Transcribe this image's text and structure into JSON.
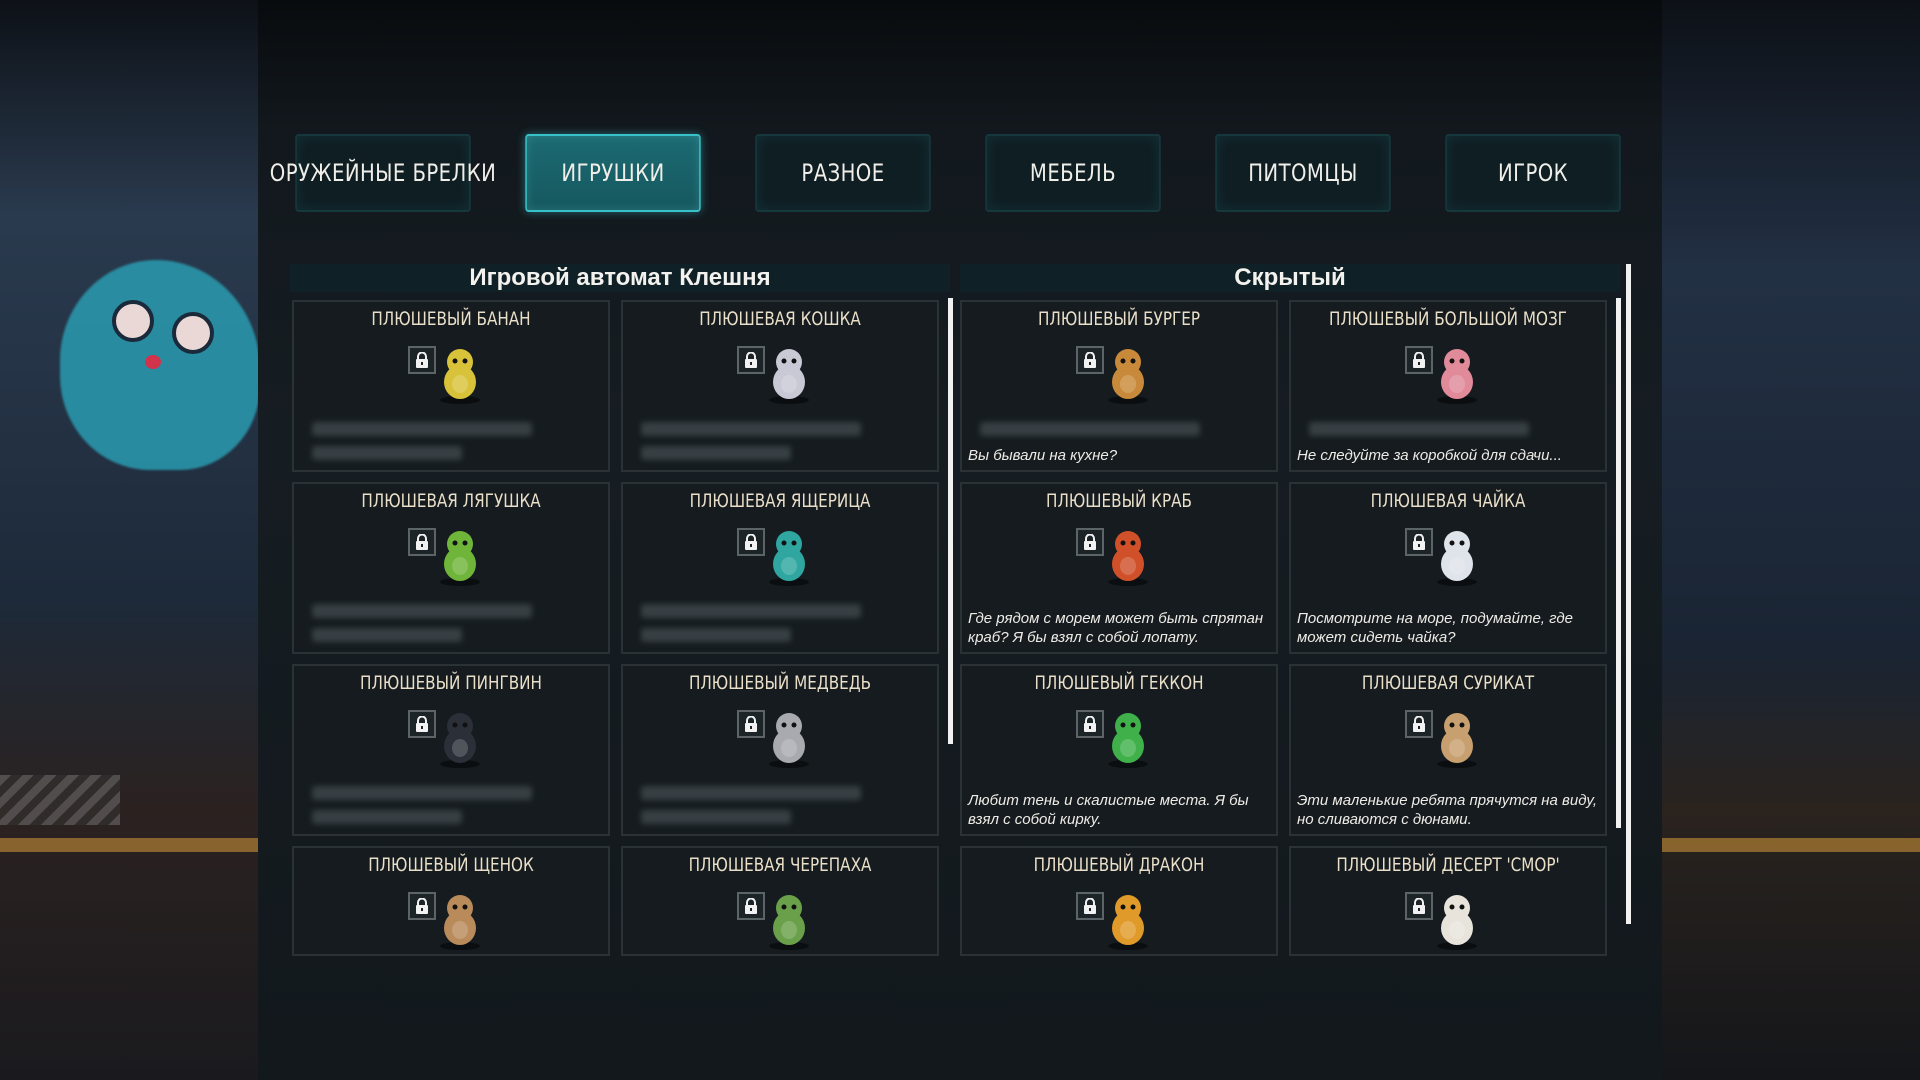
{
  "tabs": [
    {
      "label": "ОРУЖЕЙНЫЕ БРЕЛКИ",
      "active": false
    },
    {
      "label": "ИГРУШКИ",
      "active": true
    },
    {
      "label": "РАЗНОЕ",
      "active": false
    },
    {
      "label": "МЕБЕЛЬ",
      "active": false
    },
    {
      "label": "ПИТОМЦЫ",
      "active": false
    },
    {
      "label": "ИГРОК",
      "active": false
    }
  ],
  "sections": {
    "claw": {
      "title": "Игровой автомат Клешня",
      "items": [
        {
          "name": "ПЛЮШЕВЫЙ БАНАН",
          "icon": "banana-plush-icon",
          "color": "#d8c23a"
        },
        {
          "name": "ПЛЮШЕВАЯ КОШКА",
          "icon": "cat-plush-icon",
          "color": "#c9c9d6"
        },
        {
          "name": "ПЛЮШЕВАЯ ЛЯГУШКА",
          "icon": "frog-plush-icon",
          "color": "#6fb53a"
        },
        {
          "name": "ПЛЮШЕВАЯ ЯЩЕРИЦА",
          "icon": "lizard-plush-icon",
          "color": "#2fa7a0"
        },
        {
          "name": "ПЛЮШЕВЫЙ ПИНГВИН",
          "icon": "penguin-plush-icon",
          "color": "#2a2f38"
        },
        {
          "name": "ПЛЮШЕВЫЙ МЕДВЕДЬ",
          "icon": "bear-plush-icon",
          "color": "#a8aab0"
        },
        {
          "name": "ПЛЮШЕВЫЙ ЩЕНОК",
          "icon": "puppy-plush-icon",
          "color": "#b98a5a"
        },
        {
          "name": "ПЛЮШЕВАЯ ЧЕРЕПАХА",
          "icon": "turtle-plush-icon",
          "color": "#6aa04a"
        }
      ]
    },
    "hidden": {
      "title": "Скрытый",
      "items": [
        {
          "name": "ПЛЮШЕВЫЙ БУРГЕР",
          "icon": "burger-plush-icon",
          "color": "#c88a3a",
          "hint": "Вы бывали на кухне?"
        },
        {
          "name": "ПЛЮШЕВЫЙ БОЛЬШОЙ МОЗГ",
          "icon": "brain-plush-icon",
          "color": "#e08a9a",
          "hint": "Не следуйте за коробкой для сдачи..."
        },
        {
          "name": "ПЛЮШЕВЫЙ КРАБ",
          "icon": "crab-plush-icon",
          "color": "#d0502a",
          "hint": "Где рядом с морем может быть спрятан краб? Я бы взял с собой лопату."
        },
        {
          "name": "ПЛЮШЕВАЯ ЧАЙКА",
          "icon": "seagull-plush-icon",
          "color": "#dfe3ea",
          "hint": "Посмотрите на море, подумайте, где может сидеть чайка?"
        },
        {
          "name": "ПЛЮШЕВЫЙ ГЕККОН",
          "icon": "gecko-plush-icon",
          "color": "#3fb04a",
          "hint": "Любит тень и скалистые места. Я бы взял с собой кирку."
        },
        {
          "name": "ПЛЮШЕВАЯ СУРИКАТ",
          "icon": "meerkat-plush-icon",
          "color": "#c8a070",
          "hint": "Эти маленькие ребята прячутся на виду, но сливаются с дюнами."
        },
        {
          "name": "ПЛЮШЕВЫЙ ДРАКОН",
          "icon": "dragon-plush-icon",
          "color": "#e09a2a"
        },
        {
          "name": "ПЛЮШЕВЫЙ ДЕСЕРТ 'СМОР'",
          "icon": "smore-plush-icon",
          "color": "#e8e4dc"
        }
      ]
    }
  }
}
